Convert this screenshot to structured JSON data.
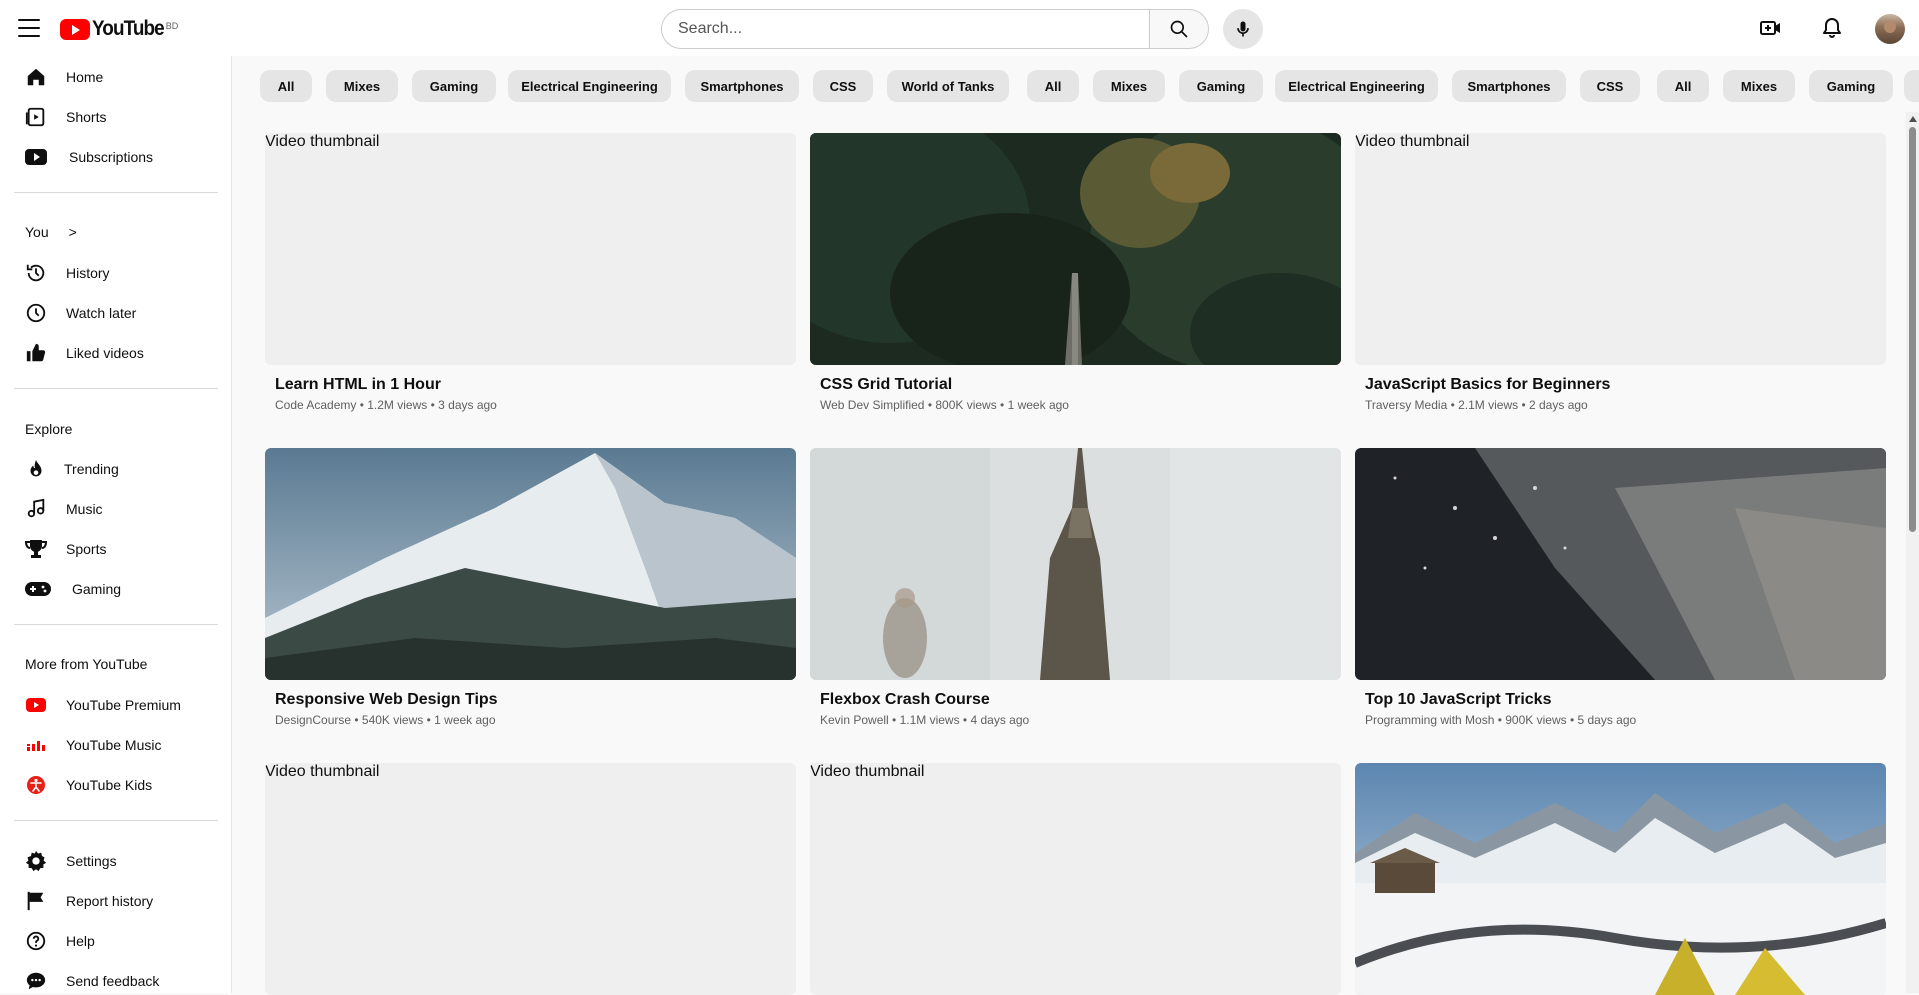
{
  "header": {
    "logo_text": "YouTube",
    "country_code": "BD",
    "search_placeholder": "Search...",
    "icons": [
      "menu-icon",
      "search-icon",
      "mic-icon",
      "create-video-icon",
      "bell-icon",
      "avatar"
    ]
  },
  "sidebar": {
    "main": [
      {
        "label": "Home",
        "icon": "home-icon"
      },
      {
        "label": "Shorts",
        "icon": "shorts-icon"
      },
      {
        "label": "Subscriptions",
        "icon": "subscriptions-icon"
      }
    ],
    "you_heading": "You",
    "you_chevron": ">",
    "you": [
      {
        "label": "History",
        "icon": "history-icon"
      },
      {
        "label": "Watch later",
        "icon": "clock-icon"
      },
      {
        "label": "Liked videos",
        "icon": "thumbs-up-icon"
      }
    ],
    "explore_heading": "Explore",
    "explore": [
      {
        "label": "Trending",
        "icon": "fire-icon"
      },
      {
        "label": "Music",
        "icon": "music-note-icon"
      },
      {
        "label": "Sports",
        "icon": "trophy-icon"
      },
      {
        "label": "Gaming",
        "icon": "gamepad-icon"
      }
    ],
    "more_heading": "More from YouTube",
    "more": [
      {
        "label": "YouTube Premium",
        "icon": "youtube-premium-icon"
      },
      {
        "label": "YouTube Music",
        "icon": "youtube-music-icon"
      },
      {
        "label": "YouTube Kids",
        "icon": "youtube-kids-icon"
      }
    ],
    "settings": [
      {
        "label": "Settings",
        "icon": "gear-icon"
      },
      {
        "label": "Report history",
        "icon": "flag-icon"
      },
      {
        "label": "Help",
        "icon": "help-icon"
      },
      {
        "label": "Send feedback",
        "icon": "feedback-icon"
      }
    ]
  },
  "chips": [
    "All",
    "Mixes",
    "Gaming",
    "Electrical Engineering",
    "Smartphones",
    "CSS",
    "World of Tanks",
    "All",
    "Mixes",
    "Gaming",
    "Electrical Engineering",
    "Smartphones",
    "CSS",
    "All",
    "Mixes",
    "Gaming"
  ],
  "videos": [
    {
      "title": "Learn HTML in 1 Hour",
      "meta": "Code Academy • 1.2M views • 3 days ago",
      "thumb_alt": "Video thumbnail",
      "thumb": "broken"
    },
    {
      "title": "CSS Grid Tutorial",
      "meta": "Web Dev Simplified • 800K views • 1 week ago",
      "thumb_alt": "",
      "thumb": "forest"
    },
    {
      "title": "JavaScript Basics for Beginners",
      "meta": "Traversy Media • 2.1M views • 2 days ago",
      "thumb_alt": "Video thumbnail",
      "thumb": "broken"
    },
    {
      "title": "Responsive Web Design Tips",
      "meta": "DesignCourse • 540K views • 1 week ago",
      "thumb_alt": "",
      "thumb": "mountain"
    },
    {
      "title": "Flexbox Crash Course",
      "meta": "Kevin Powell • 1.1M views • 4 days ago",
      "thumb_alt": "",
      "thumb": "tower"
    },
    {
      "title": "Top 10 JavaScript Tricks",
      "meta": "Programming with Mosh • 900K views • 5 days ago",
      "thumb_alt": "",
      "thumb": "snow-ground"
    },
    {
      "title": "",
      "meta": "",
      "thumb_alt": "Video thumbnail",
      "thumb": "broken"
    },
    {
      "title": "",
      "meta": "",
      "thumb_alt": "Video thumbnail",
      "thumb": "broken"
    },
    {
      "title": "",
      "meta": "",
      "thumb_alt": "",
      "thumb": "snow-camp"
    }
  ]
}
